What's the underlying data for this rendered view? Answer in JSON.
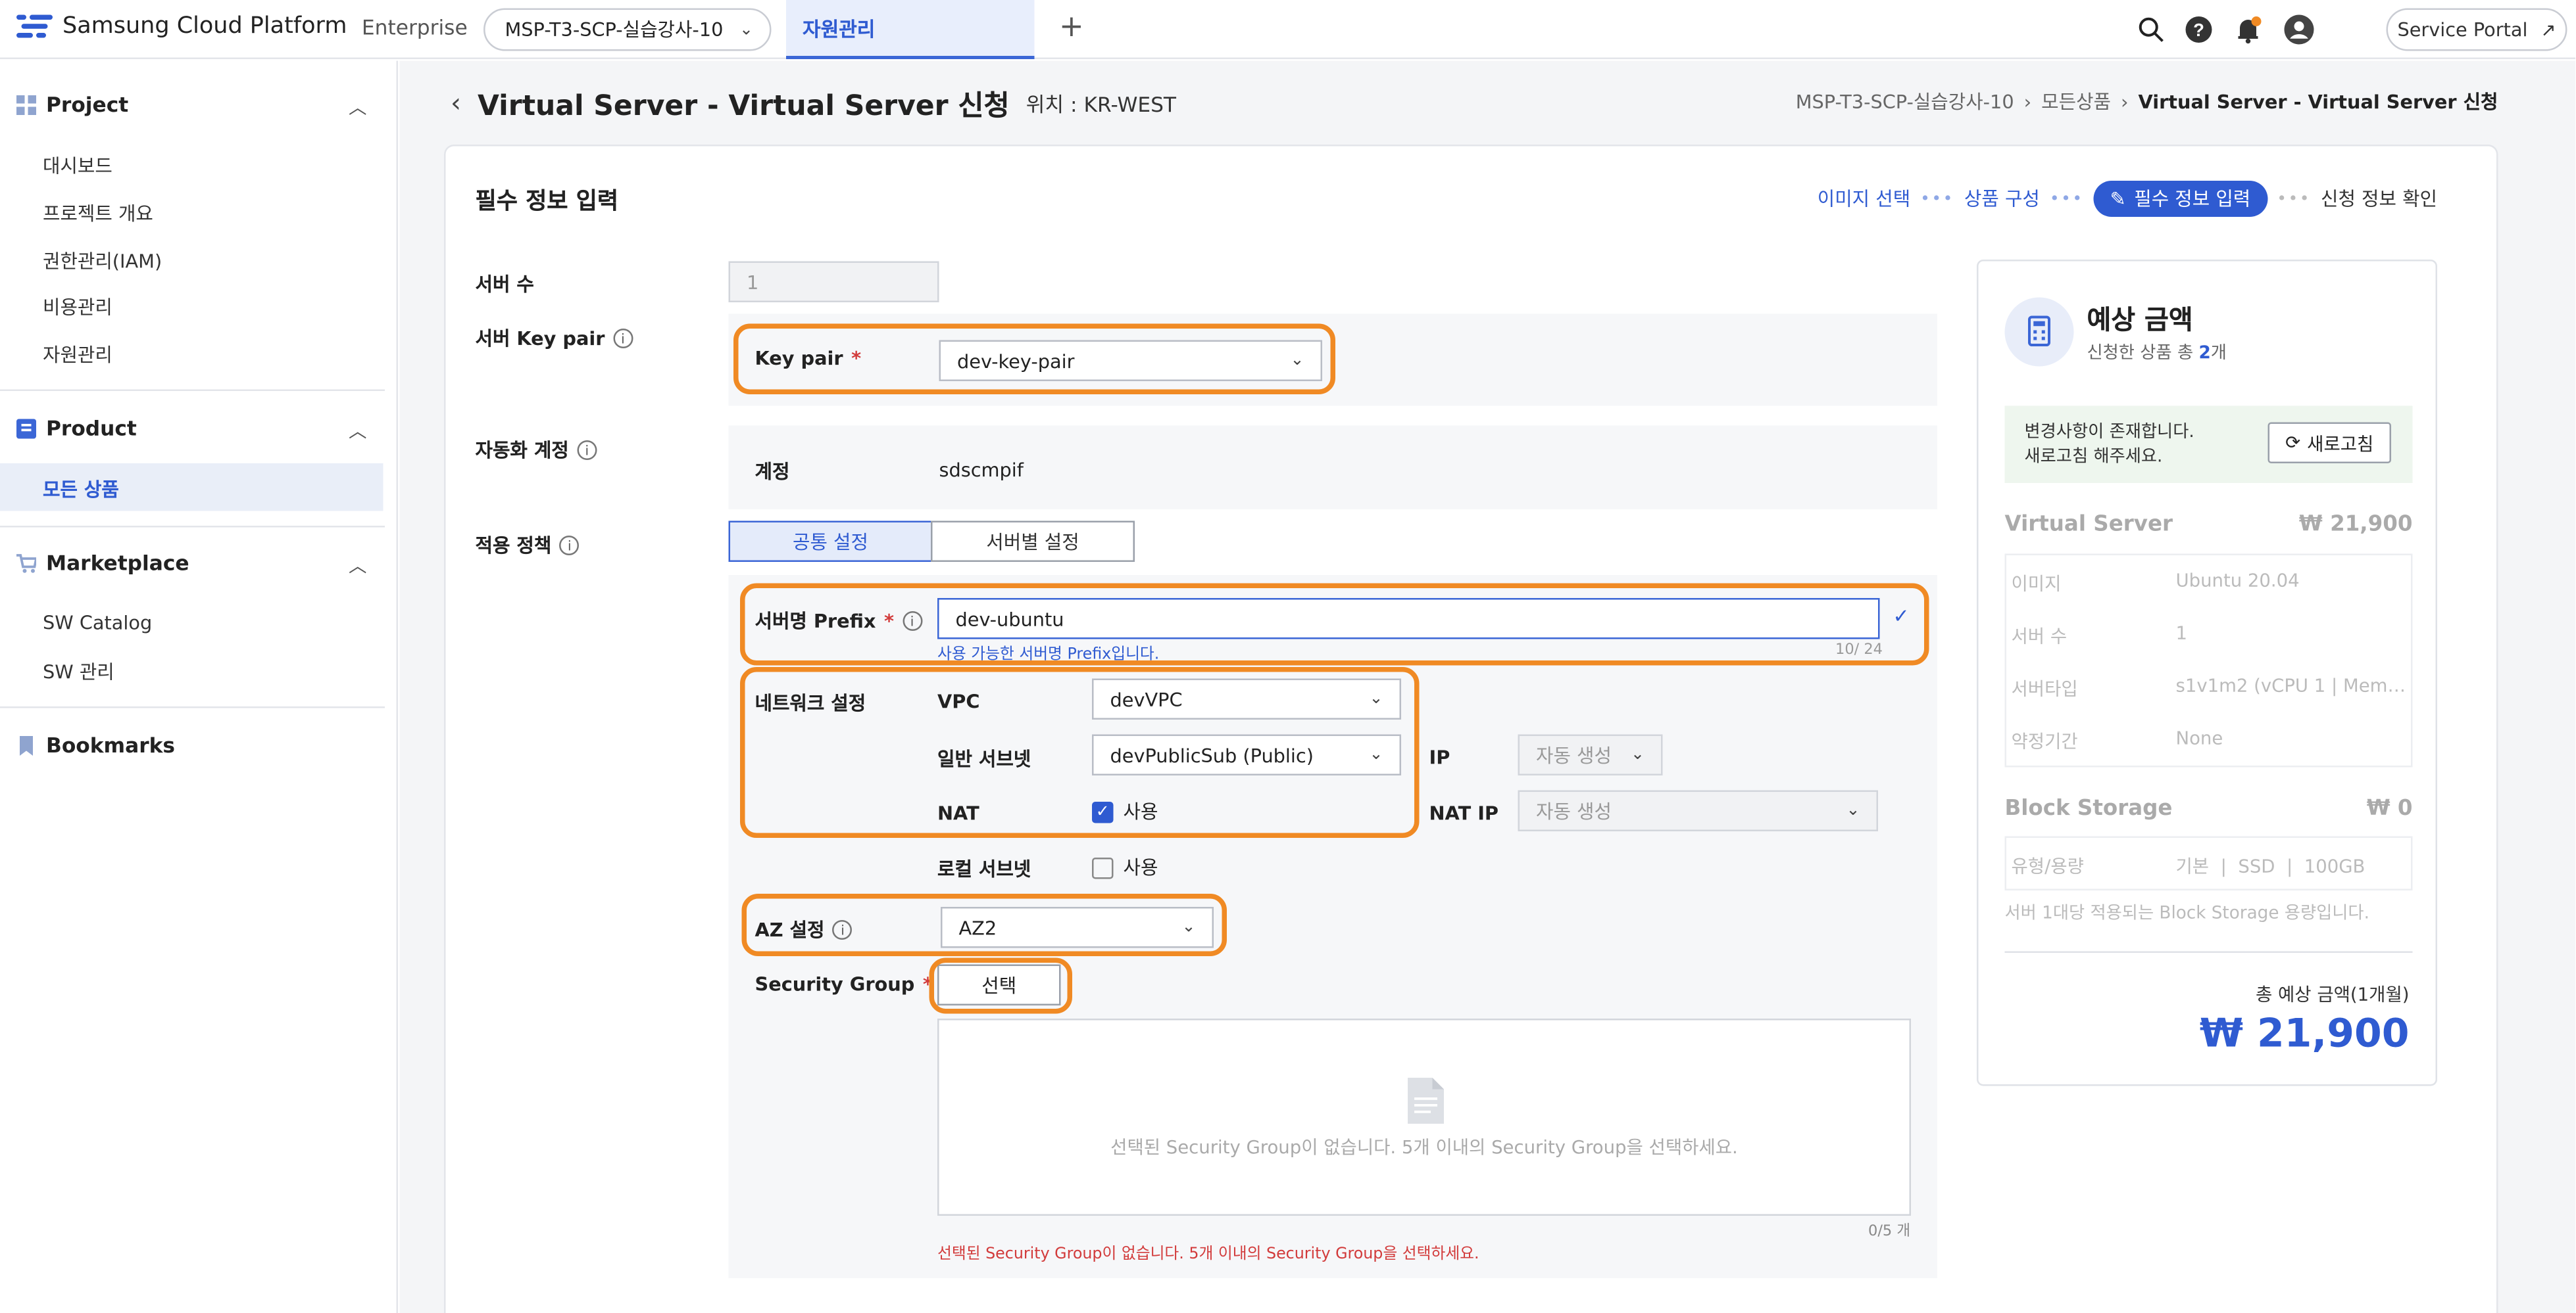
{
  "topbar": {
    "logo_text": "Samsung Cloud Platform",
    "logo_edition": "Enterprise",
    "project_select": "MSP-T3-SCP-실습강사-10",
    "active_tab": "자원관리",
    "service_portal": "Service Portal"
  },
  "sidebar": {
    "project_label": "Project",
    "project_items": [
      "대시보드",
      "프로젝트 개요",
      "권한관리(IAM)",
      "비용관리",
      "자원관리"
    ],
    "product_label": "Product",
    "product_items": [
      "모든 상품"
    ],
    "marketplace_label": "Marketplace",
    "marketplace_items": [
      "SW Catalog",
      "SW 관리"
    ],
    "bookmarks_label": "Bookmarks"
  },
  "page": {
    "title": "Virtual Server - Virtual Server 신청",
    "location": "위치 : KR-WEST",
    "breadcrumb": [
      "MSP-T3-SCP-실습강사-10",
      "모든상품",
      "Virtual Server - Virtual Server 신청"
    ]
  },
  "steps": {
    "items": [
      "이미지 선택",
      "상품 구성",
      "필수 정보 입력",
      "신청 정보 확인"
    ]
  },
  "form": {
    "section_title": "필수 정보 입력",
    "server_count_label": "서버 수",
    "server_count_value": "1",
    "keypair_section_label": "서버 Key pair",
    "keypair_label": "Key pair",
    "keypair_value": "dev-key-pair",
    "automation_label": "자동화 계정",
    "account_label": "계정",
    "account_value": "sdscmpif",
    "policy_label": "적용 정책",
    "policy_tabs": [
      "공통 설정",
      "서버별 설정"
    ],
    "prefix_label": "서버명 Prefix",
    "prefix_value": "dev-ubuntu",
    "prefix_help": "사용 가능한 서버명 Prefix입니다.",
    "prefix_count": "10/ 24",
    "network_label": "네트워크 설정",
    "vpc_label": "VPC",
    "vpc_value": "devVPC",
    "subnet_label": "일반 서브넷",
    "subnet_value": "devPublicSub (Public)",
    "ip_label": "IP",
    "ip_value": "자동 생성",
    "nat_label": "NAT",
    "nat_check": "사용",
    "natip_label": "NAT IP",
    "natip_value": "자동 생성",
    "local_subnet_label": "로컬 서브넷",
    "local_subnet_check": "사용",
    "az_label": "AZ 설정",
    "az_value": "AZ2",
    "sg_label": "Security Group",
    "sg_button": "선택",
    "sg_empty": "선택된 Security Group이 없습니다. 5개 이내의 Security Group을 선택하세요.",
    "sg_count": "0/5 개",
    "sg_error": "선택된 Security Group이 없습니다. 5개 이내의 Security Group을 선택하세요."
  },
  "price": {
    "title": "예상 금액",
    "subtitle_prefix": "신청한 상품 총 ",
    "subtitle_count": "2",
    "subtitle_suffix": "개",
    "notice_line1": "변경사항이 존재합니다.",
    "notice_line2": "새로고침 해주세요.",
    "refresh_button": "새로고침",
    "vs_title": "Virtual Server",
    "vs_price": "₩ 21,900",
    "vs_rows": [
      {
        "k": "이미지",
        "v": "Ubuntu 20.04"
      },
      {
        "k": "서버 수",
        "v": "1"
      },
      {
        "k": "서버타입",
        "v": "s1v1m2 (vCPU 1 | Mem…"
      },
      {
        "k": "약정기간",
        "v": "None"
      }
    ],
    "bs_title": "Block Storage",
    "bs_price": "₩ 0",
    "bs_row_label": "유형/용량",
    "bs_row_vals": [
      "기본",
      "SSD",
      "100GB"
    ],
    "bs_note": "서버 1대당 적용되는 Block Storage 용량입니다.",
    "total_label": "총 예상 금액(1개월)",
    "total_value": "₩ 21,900"
  },
  "colors": {
    "accent": "#2f5bd1",
    "highlight": "#f08a24",
    "error": "#d23b3b"
  }
}
